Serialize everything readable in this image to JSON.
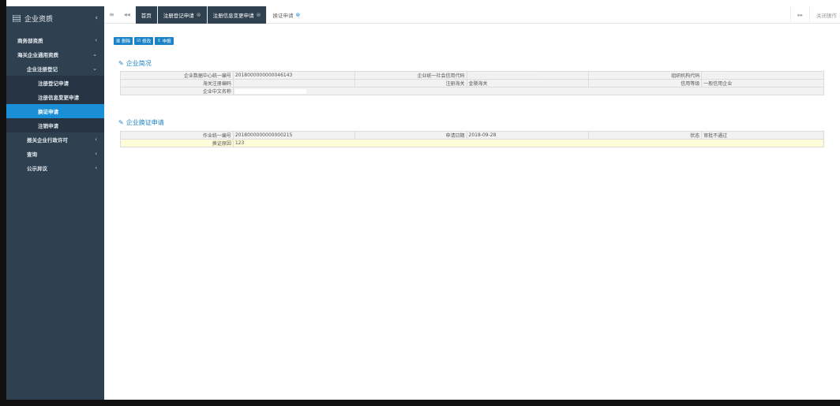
{
  "sidebar": {
    "title": "企业资质",
    "collapse_glyph": "‹",
    "items": [
      {
        "label": "商务部资质",
        "arrow": "‹"
      },
      {
        "label": "海关企业通用资质",
        "arrow": "⌄"
      },
      {
        "label": "企业注册登记",
        "arrow": "⌄"
      },
      {
        "label": "注册登记申请"
      },
      {
        "label": "注册信息变更申请"
      },
      {
        "label": "换证申请"
      },
      {
        "label": "注销申请"
      },
      {
        "label": "报关企业行政许可",
        "arrow": "‹"
      },
      {
        "label": "查询",
        "arrow": "‹"
      },
      {
        "label": "公示异议",
        "arrow": "‹"
      }
    ]
  },
  "topbar": {
    "menu_glyph": "≡",
    "back_glyph": "◂◂",
    "tabs": [
      {
        "label": "首页"
      },
      {
        "label": "注册登记申请",
        "close": "⊗"
      },
      {
        "label": "注册信息变更申请",
        "close": "⊗"
      },
      {
        "label": "换证申请",
        "close": "⊗"
      }
    ],
    "forward_glyph": "▸▸",
    "close_ops": "关闭操作"
  },
  "toolbar": {
    "delete_label": "删除",
    "edit_label": "修改",
    "declare_label": "申报"
  },
  "section1": {
    "title": "企业简况",
    "rows": [
      [
        "企业数据中心统一编号",
        "2018000000000046143",
        "企业统一社会信用代码",
        "",
        "组织机构代码",
        ""
      ],
      [
        "海关注册编码",
        "",
        "注册海关",
        "金陵海关",
        "信用等级",
        "一般信用企业"
      ],
      [
        "企业中文名称",
        ""
      ]
    ]
  },
  "section2": {
    "title": "企业换证申请",
    "rows": [
      [
        "作业统一编号",
        "2018000000000000215",
        "申请日期",
        "2018-09-28",
        "状态",
        "审批不通过"
      ],
      [
        "换证原因",
        "123"
      ]
    ]
  },
  "colors": {
    "sidebar_bg": "#2f4050",
    "accent": "#1c84c6",
    "active_item": "#1a8fd8",
    "highlight_row": "#fdfbd8"
  }
}
